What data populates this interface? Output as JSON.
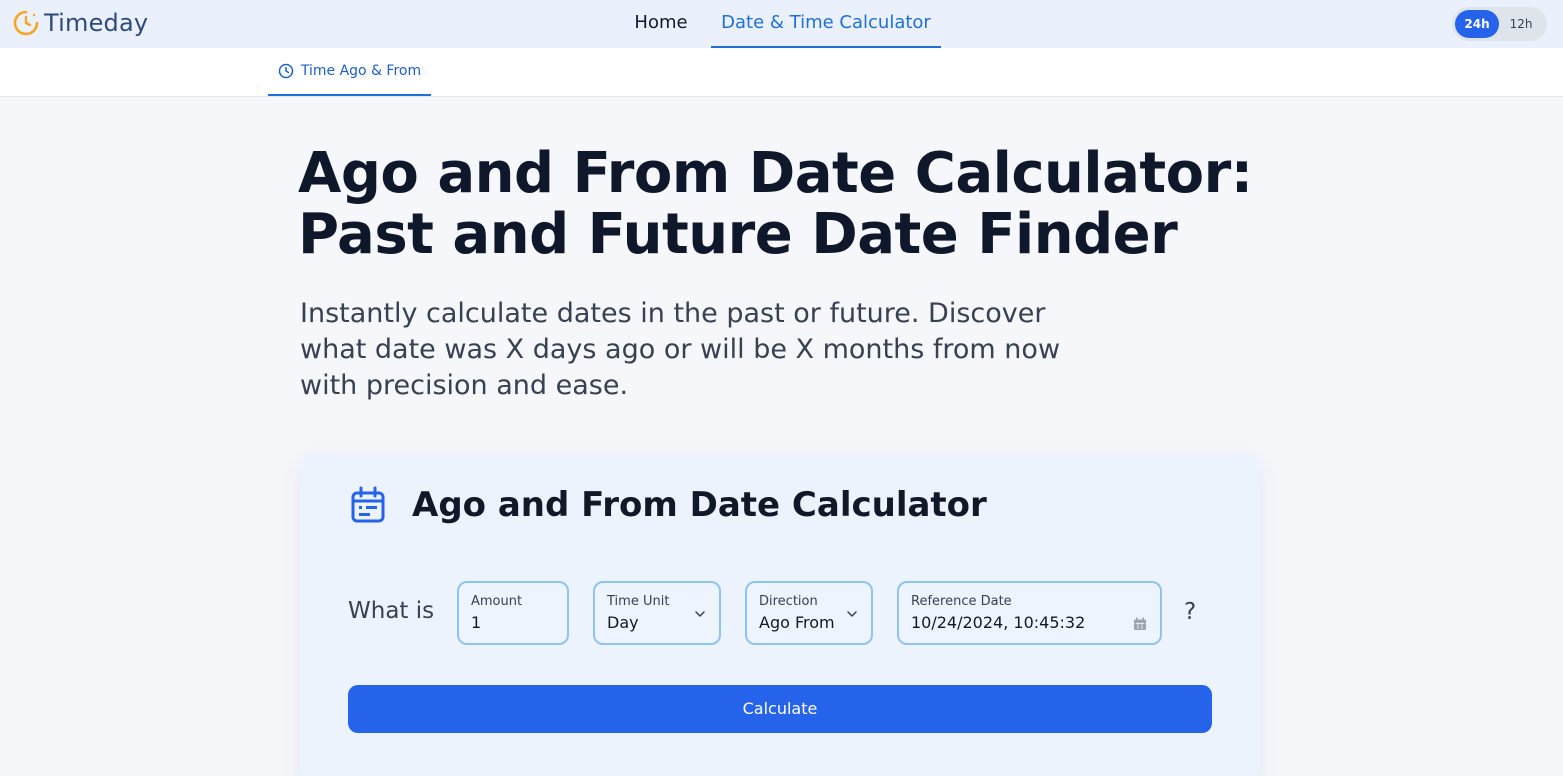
{
  "header": {
    "logo_text": "Timeday",
    "nav": [
      {
        "label": "Home"
      },
      {
        "label": "Date & Time Calculator"
      }
    ],
    "time_format": {
      "options": [
        "24h",
        "12h"
      ],
      "selected": "24h"
    }
  },
  "subnav": {
    "tab_label": "Time Ago & From",
    "tab_icon": "clock-icon"
  },
  "hero": {
    "title_line1": "Ago and From Date Calculator:",
    "title_line2": "Past and Future Date Finder",
    "description": "Instantly calculate dates in the past or future. Discover what date was X days ago or will be X months from now with precision and ease."
  },
  "calculator": {
    "icon": "calendar-icon",
    "title": "Ago and From Date Calculator",
    "prompt": "What is",
    "amount": {
      "label": "Amount",
      "value": "1"
    },
    "time_unit": {
      "label": "Time Unit",
      "value": "Day"
    },
    "direction": {
      "label": "Direction",
      "value": "Ago From"
    },
    "reference_date": {
      "label": "Reference Date",
      "value": "10/24/2024, 10:45:32"
    },
    "help_symbol": "?",
    "calculate_label": "Calculate"
  },
  "colors": {
    "accent": "#2563eb",
    "nav_active": "#1f6fd8",
    "header_bg": "#eaf1fc",
    "card_bg": "#edf3fd",
    "field_border": "#8fc3f0",
    "logo_icon": "#f5a623"
  }
}
